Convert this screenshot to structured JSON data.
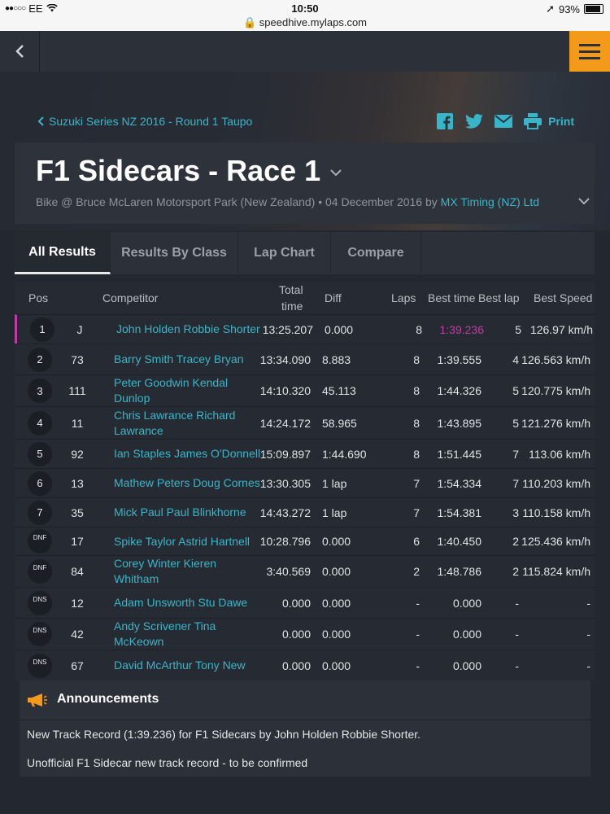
{
  "status_bar": {
    "carrier": "EE",
    "time": "10:50",
    "url": "speedhive.mylaps.com",
    "battery": "93%"
  },
  "breadcrumb": "Suzuki Series NZ 2016 - Round 1 Taupo",
  "share": {
    "print_label": "Print"
  },
  "event": {
    "title": "F1 Sidecars - Race 1",
    "subtitle": "Bike @ Bruce McLaren Motorsport Park (New Zealand) • 04 December 2016 by",
    "organizer": "MX Timing (NZ) Ltd"
  },
  "tabs": [
    "All Results",
    "Results By Class",
    "Lap Chart",
    "Compare"
  ],
  "columns": {
    "pos": "Pos",
    "competitor": "Competitor",
    "total_time_1": "Total",
    "total_time_2": "time",
    "diff": "Diff",
    "laps": "Laps",
    "best_time": "Best time",
    "best_lap": "Best lap",
    "best_speed": "Best Speed"
  },
  "results": [
    {
      "pos": "1",
      "num": "J",
      "comp1": "John Holden Robbie Shorter",
      "comp2": "",
      "total": "13:25.207",
      "diff": "0.000",
      "laps": "8",
      "best_time": "1:39.236",
      "best_lap": "5",
      "speed": "126.97 km/h"
    },
    {
      "pos": "2",
      "num": "73",
      "comp1": "Barry Smith Tracey Bryan",
      "comp2": "",
      "total": "13:34.090",
      "diff": "8.883",
      "laps": "8",
      "best_time": "1:39.555",
      "best_lap": "4",
      "speed": "126.563 km/h"
    },
    {
      "pos": "3",
      "num": "111",
      "comp1": "Peter Goodwin Kendal",
      "comp2": "Dunlop",
      "total": "14:10.320",
      "diff": "45.113",
      "laps": "8",
      "best_time": "1:44.326",
      "best_lap": "5",
      "speed": "120.775 km/h"
    },
    {
      "pos": "4",
      "num": "11",
      "comp1": "Chris Lawrance Richard",
      "comp2": "Lawrance",
      "total": "14:24.172",
      "diff": "58.965",
      "laps": "8",
      "best_time": "1:43.895",
      "best_lap": "5",
      "speed": "121.276 km/h"
    },
    {
      "pos": "5",
      "num": "92",
      "comp1": "Ian Staples James O'Donnell",
      "comp2": "",
      "total": "15:09.897",
      "diff": "1:44.690",
      "laps": "8",
      "best_time": "1:51.445",
      "best_lap": "7",
      "speed": "113.06 km/h"
    },
    {
      "pos": "6",
      "num": "13",
      "comp1": "Mathew Peters Doug Cornes",
      "comp2": "",
      "total": "13:30.305",
      "diff": "1 lap",
      "laps": "7",
      "best_time": "1:54.334",
      "best_lap": "7",
      "speed": "110.203 km/h"
    },
    {
      "pos": "7",
      "num": "35",
      "comp1": "Mick Paul Paul Blinkhorne",
      "comp2": "",
      "total": "14:43.272",
      "diff": "1 lap",
      "laps": "7",
      "best_time": "1:54.381",
      "best_lap": "3",
      "speed": "110.158 km/h"
    },
    {
      "pos": "DNF",
      "num": "17",
      "comp1": "Spike Taylor Astrid Hartnell",
      "comp2": "",
      "total": "10:28.796",
      "diff": "0.000",
      "laps": "6",
      "best_time": "1:40.450",
      "best_lap": "2",
      "speed": "125.436 km/h"
    },
    {
      "pos": "DNF",
      "num": "84",
      "comp1": "Corey Winter Kieren",
      "comp2": "Whitham",
      "total": "3:40.569",
      "diff": "0.000",
      "laps": "2",
      "best_time": "1:48.786",
      "best_lap": "2",
      "speed": "115.824 km/h"
    },
    {
      "pos": "DNS",
      "num": "12",
      "comp1": "Adam Unsworth Stu Dawe",
      "comp2": "",
      "total": "0.000",
      "diff": "0.000",
      "laps": "-",
      "best_time": "0.000",
      "best_lap": "-",
      "speed": "-"
    },
    {
      "pos": "DNS",
      "num": "42",
      "comp1": "Andy Scrivener Tina",
      "comp2": "McKeown",
      "total": "0.000",
      "diff": "0.000",
      "laps": "-",
      "best_time": "0.000",
      "best_lap": "-",
      "speed": "-"
    },
    {
      "pos": "DNS",
      "num": "67",
      "comp1": "David McArthur Tony New",
      "comp2": "",
      "total": "0.000",
      "diff": "0.000",
      "laps": "-",
      "best_time": "0.000",
      "best_lap": "-",
      "speed": "-"
    }
  ],
  "announcements": {
    "title": "Announcements",
    "items": [
      "New Track Record (1:39.236) for F1 Sidecars by John Holden Robbie Shorter.",
      "Unofficial F1 Sidecar new track record - to be confirmed"
    ]
  }
}
